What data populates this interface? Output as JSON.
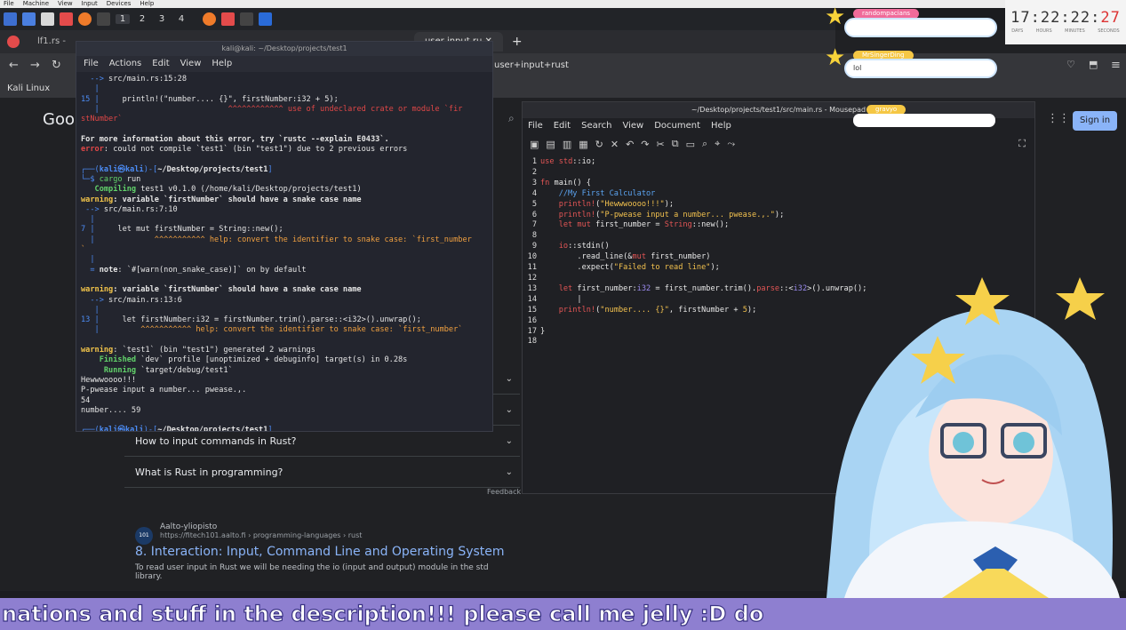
{
  "vm_menu": [
    "File",
    "Machine",
    "View",
    "Input",
    "Devices",
    "Help"
  ],
  "workspaces": [
    "1",
    "2",
    "3",
    "4"
  ],
  "browser": {
    "tabs": [
      "lf1.rs -",
      "user input ru"
    ],
    "url": "user+input+rust",
    "bookmark": "Kali Linux",
    "google_fragment": "Goo",
    "signin": "Sign in",
    "faq": [
      "How to input commands in Rust?",
      "What is Rust in programming?"
    ],
    "feedback": "Feedback",
    "result": {
      "logo": "101",
      "source": "Aalto-yliopisto",
      "url": "https://fitech101.aalto.fi › programming-languages › rust",
      "title": "8. Interaction: Input, Command Line and Operating System",
      "snippet": "To read user input in Rust we will be needing the io (input and output) module in the std library."
    }
  },
  "terminal": {
    "title": "kali@kali: ~/Desktop/projects/test1",
    "menu": [
      "File",
      "Actions",
      "Edit",
      "View",
      "Help"
    ]
  },
  "editor": {
    "title": "~/Desktop/projects/test1/src/main.rs - Mousepad",
    "menu": [
      "File",
      "Edit",
      "Search",
      "View",
      "Document",
      "Help"
    ],
    "line_numbers": [
      "1",
      "2",
      "3",
      "4",
      "5",
      "6",
      "7",
      "8",
      "9",
      "10",
      "11",
      "12",
      "13",
      "14",
      "15",
      "16",
      "17",
      "18"
    ]
  },
  "clock": {
    "h": "17",
    "m": "22",
    "s": "22",
    "f": "27",
    "labels": [
      "DAYS",
      "HOURS",
      "MINUTES",
      "SECONDS"
    ]
  },
  "chat": [
    {
      "name": "randompacians",
      "msg": ""
    },
    {
      "name": "MrSingerDing",
      "msg": "lol"
    },
    {
      "name": "gravyo",
      "msg": ""
    }
  ],
  "ticker": "nations and stuff in the description!!! please call me jelly :D do",
  "colors": {
    "accent": "#8ab4f8",
    "ticker": "#8e7fd0",
    "term_bg": "#23252e"
  }
}
